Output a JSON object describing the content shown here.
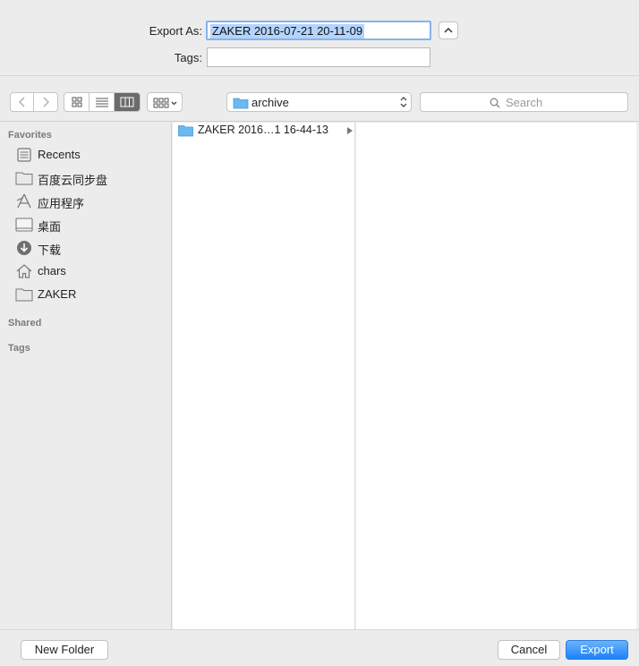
{
  "form": {
    "export_label": "Export As:",
    "export_value": "ZAKER 2016-07-21 20-11-09",
    "tags_label": "Tags:",
    "tags_value": ""
  },
  "toolbar": {
    "back_icon": "chevron-left-icon",
    "forward_icon": "chevron-right-icon",
    "views": [
      "icon-view",
      "list-view",
      "column-view"
    ],
    "active_view": "column-view",
    "location": "archive",
    "search_placeholder": "Search"
  },
  "sidebar": {
    "favorites_header": "Favorites",
    "favorites": [
      {
        "label": "Recents",
        "icon": "recents-icon"
      },
      {
        "label": "百度云同步盘",
        "icon": "folder-icon"
      },
      {
        "label": "应用程序",
        "icon": "applications-icon"
      },
      {
        "label": "桌面",
        "icon": "desktop-icon"
      },
      {
        "label": "下载",
        "icon": "downloads-icon"
      },
      {
        "label": "chars",
        "icon": "home-icon"
      },
      {
        "label": "ZAKER",
        "icon": "folder-icon"
      }
    ],
    "shared_header": "Shared",
    "tags_header": "Tags"
  },
  "browser": {
    "column1": [
      {
        "name": "ZAKER 2016…1 16-44-13",
        "type": "folder"
      }
    ]
  },
  "buttons": {
    "new_folder": "New Folder",
    "cancel": "Cancel",
    "export": "Export"
  },
  "colors": {
    "accent": "#1a82fb",
    "folder": "#6cb8f0",
    "selection": "#b3d4fd"
  }
}
